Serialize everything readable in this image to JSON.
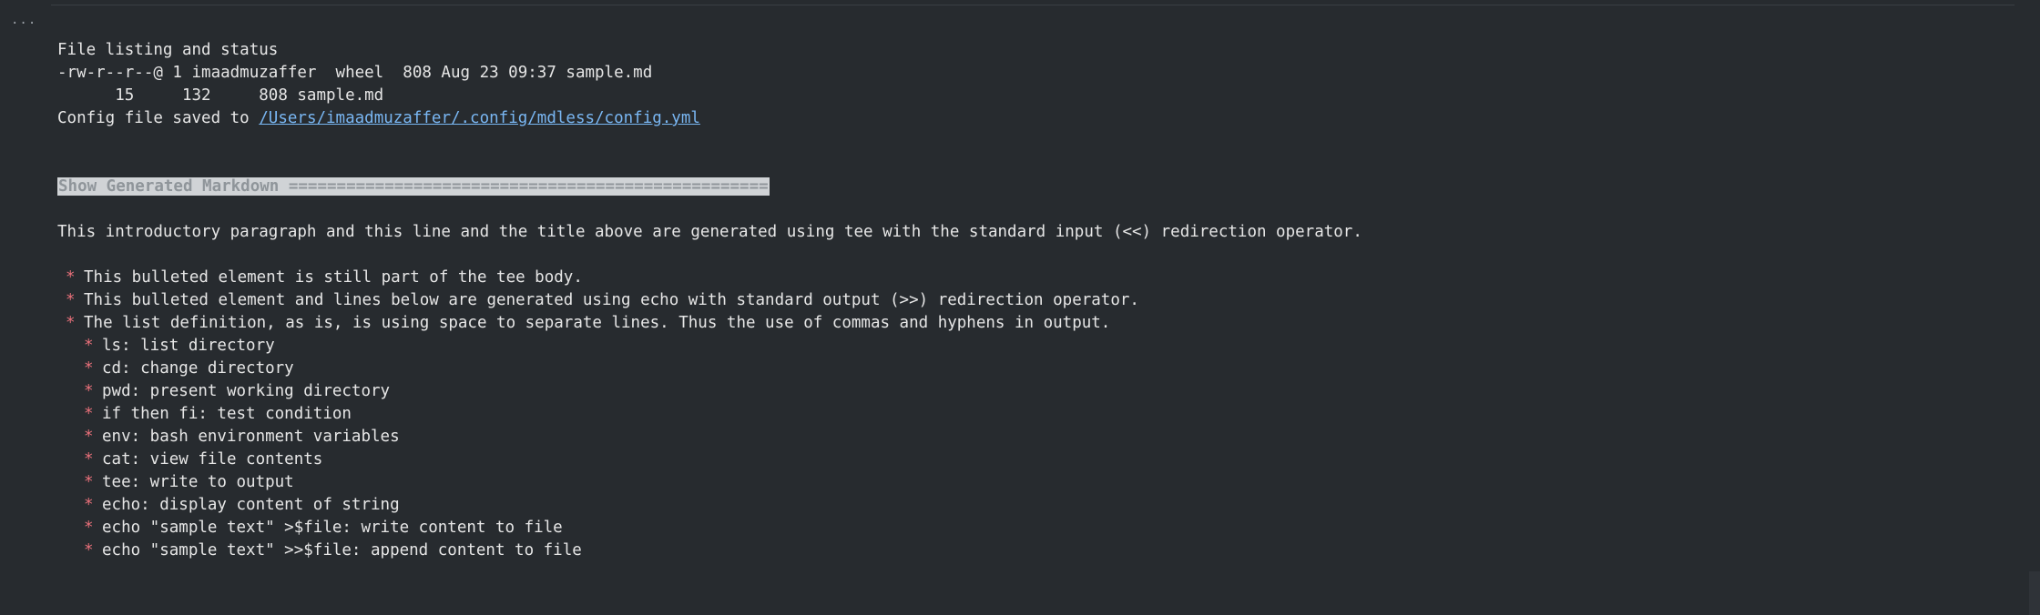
{
  "menu_icon": "ellipsis-icon",
  "terminal": {
    "section_title": "File listing and status",
    "ls_output": "-rw-r--r--@ 1 imaadmuzaffer  wheel  808 Aug 23 09:37 sample.md",
    "wc_output": "      15     132     808 sample.md",
    "config_prefix": "Config file saved to ",
    "config_path": "/Users/imaadmuzaffer/.config/mdless/config.yml"
  },
  "markdown": {
    "heading": "Show Generated Markdown ==================================================",
    "intro": "This introductory paragraph and this line and the title above are generated using tee with the standard input (<<) redirection operator.",
    "bullet_glyph": "*",
    "bullets": [
      "This bulleted element is still part of the tee body.",
      "This bulleted element and lines below are generated using echo with standard output (>>) redirection operator.",
      "The list definition, as is, is using space to separate lines. Thus the use of commas and hyphens in output."
    ],
    "sub_bullets": [
      "ls: list directory",
      "cd: change directory",
      "pwd: present working directory",
      "if then fi: test condition",
      "env: bash environment variables",
      "cat: view file contents",
      "tee: write to output",
      "echo: display content of string",
      "echo \"sample text\" >$file: write content to file",
      "echo \"sample text\" >>$file: append content to file"
    ]
  },
  "colors": {
    "background": "#272b2f",
    "text": "#e6e6e6",
    "link": "#79b6f2",
    "bullet": "#e8707a",
    "heading_bg": "#d0d3d6"
  }
}
